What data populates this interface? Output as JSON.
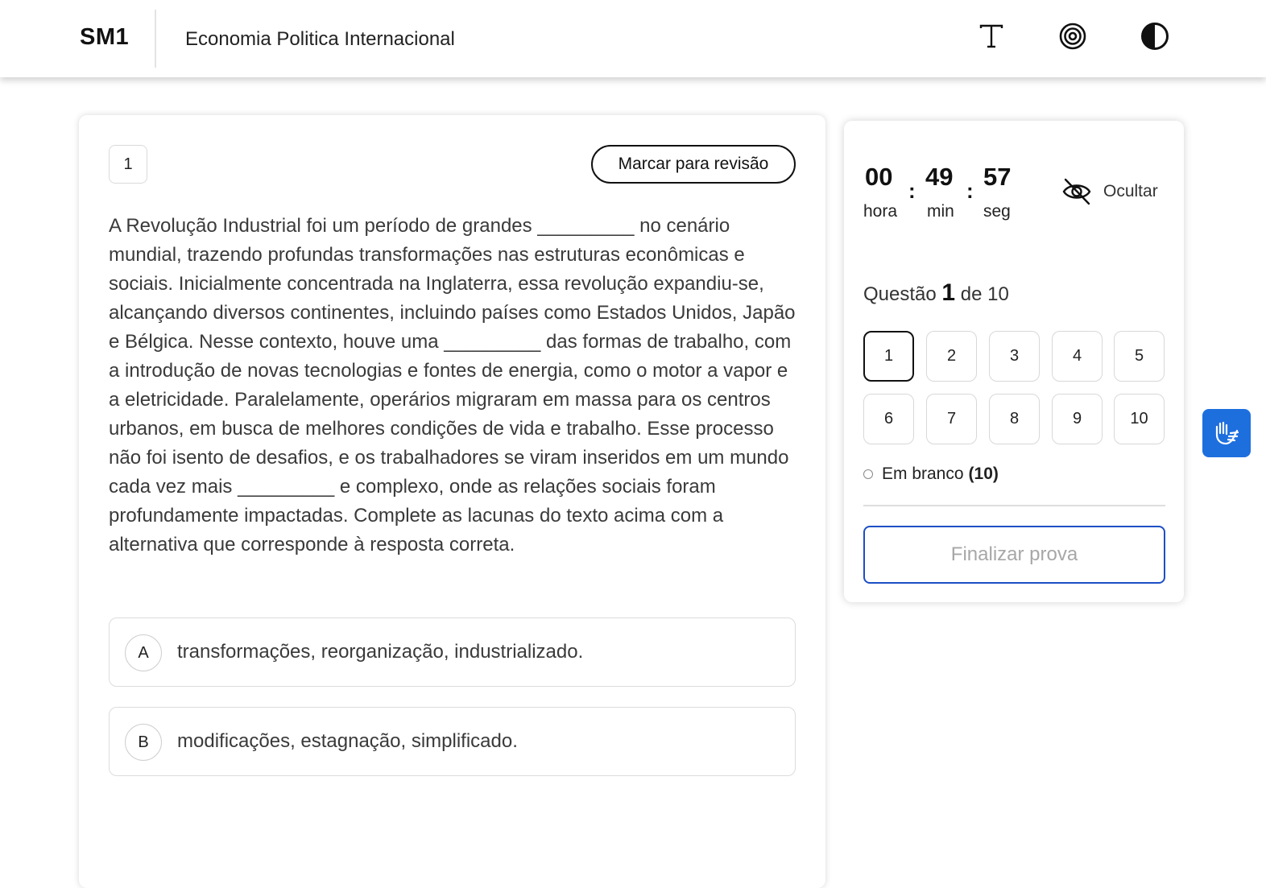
{
  "header": {
    "brand": "SM1",
    "course_title": "Economia Politica Internacional",
    "icons": [
      "text-size-icon",
      "target-icon",
      "contrast-icon"
    ]
  },
  "question": {
    "number": "1",
    "review_button": "Marcar para revisão",
    "text": "A Revolução Industrial foi um período de grandes _________ no cenário mundial, trazendo profundas transformações nas estruturas econômicas e sociais. Inicialmente concentrada na Inglaterra, essa revolução expandiu-se, alcançando diversos continentes, incluindo países como Estados Unidos, Japão e Bélgica. Nesse contexto, houve uma _________ das formas de trabalho, com a introdução de novas tecnologias e fontes de energia, como o motor a vapor e a eletricidade. Paralelamente, operários migraram em massa para os centros urbanos, em busca de melhores condições de vida e trabalho. Esse processo não foi isento de desafios, e os trabalhadores se viram inseridos em um mundo cada vez mais _________ e complexo, onde as relações sociais foram profundamente impactadas. Complete as lacunas do texto acima com a alternativa que corresponde à resposta correta.",
    "options": [
      {
        "letter": "A",
        "text": "transformações, reorganização, industrializado."
      },
      {
        "letter": "B",
        "text": "modificações, estagnação, simplificado."
      }
    ]
  },
  "timer": {
    "hours": "00",
    "minutes": "49",
    "seconds": "57",
    "colon": ":",
    "hours_label": "hora",
    "minutes_label": "min",
    "seconds_label": "seg",
    "hide_label": "Ocultar"
  },
  "navigator": {
    "prefix": "Questão",
    "current": "1",
    "suffix": "de 10",
    "questions": [
      "1",
      "2",
      "3",
      "4",
      "5",
      "6",
      "7",
      "8",
      "9",
      "10"
    ],
    "active": "1",
    "blank_label": "Em branco",
    "blank_count": "(10)",
    "finish_button": "Finalizar prova"
  },
  "colors": {
    "accent_blue": "#1c4fc4",
    "libras_blue": "#1d6fde"
  },
  "accessibility": {
    "libras_icon": "sign-language-hands-icon"
  }
}
